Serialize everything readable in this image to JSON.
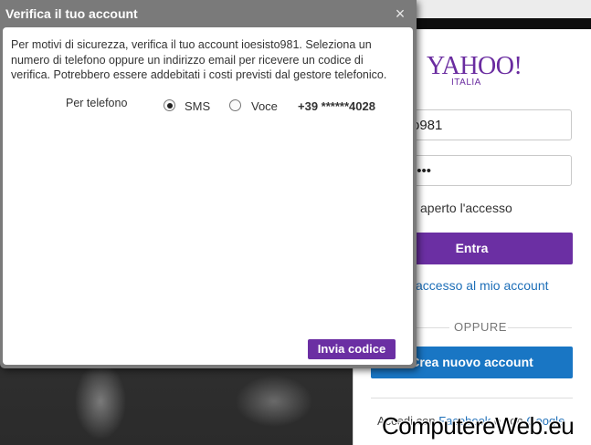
{
  "dialog": {
    "title": "Verifica il tuo account",
    "close_icon": "close-icon",
    "message": "Per motivi di sicurezza, verifica il tuo account ioesisto981. Seleziona un numero di telefono oppure un indirizzo email per ricevere un codice di verifica. Potrebbero essere addebitati i costi previsti dal gestore telefonico.",
    "phone_label": "Per telefono",
    "options": [
      {
        "label": "SMS",
        "selected": true
      },
      {
        "label": "Voce",
        "selected": false
      }
    ],
    "phone_number": "+39 ******4028",
    "send_button": "Invia codice"
  },
  "login": {
    "logo": "YAHOO!",
    "logo_sub": "ITALIA",
    "username_partial": "o981",
    "password_masked": "••••",
    "remember_partial": "aperto l'accesso",
    "signin_button": "Entra",
    "forgot_link_partial": "accesso al mio account",
    "or_text": "OPPURE",
    "create_button": "Crea nuovo account",
    "social_prefix": "Accedi con",
    "social_facebook": "Facebook",
    "social_mid": "o con",
    "social_google": "Google"
  },
  "watermark": "ComputereWeb.eu",
  "colors": {
    "yahoo_purple": "#6b2fa3",
    "link_blue": "#1e6fb8",
    "create_blue": "#1976c4",
    "dialog_header": "#7a7a7a"
  }
}
